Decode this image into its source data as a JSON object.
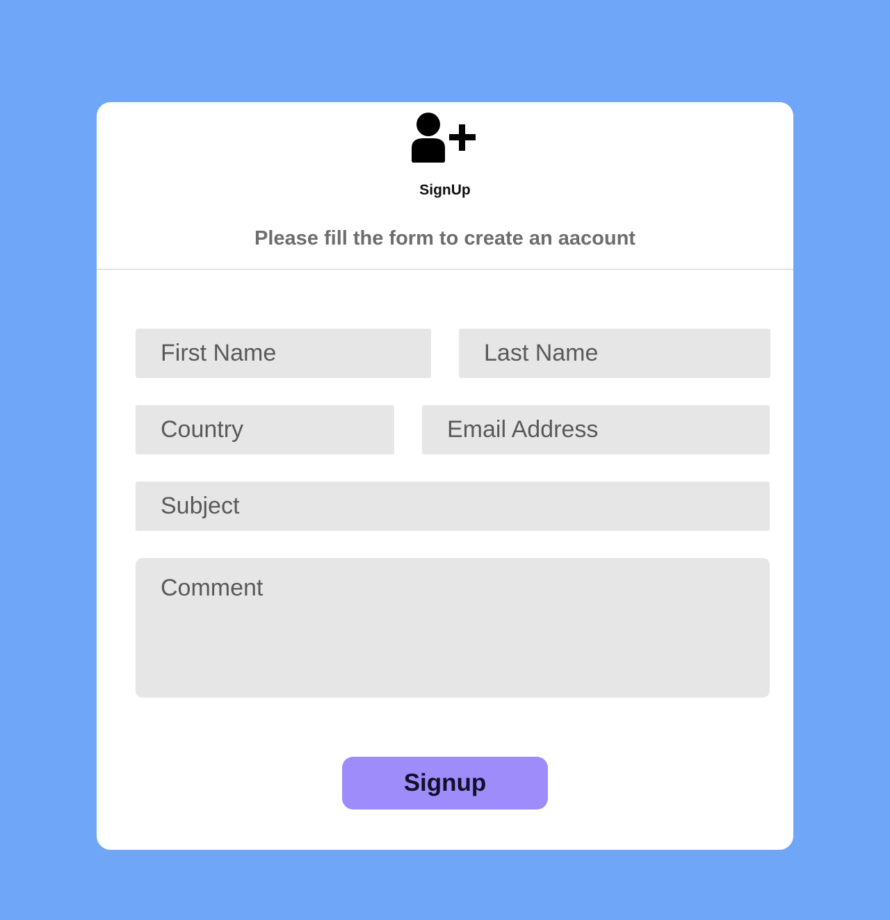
{
  "header": {
    "icon": "user-plus-icon",
    "title": "SignUp",
    "subtitle": "Please fill the form to create an aacount"
  },
  "form": {
    "first_name": {
      "placeholder": "First Name",
      "value": ""
    },
    "last_name": {
      "placeholder": "Last Name",
      "value": ""
    },
    "country": {
      "placeholder": "Country",
      "value": ""
    },
    "email": {
      "placeholder": "Email Address",
      "value": ""
    },
    "subject": {
      "placeholder": "Subject",
      "value": ""
    },
    "comment": {
      "placeholder": "Comment",
      "value": ""
    },
    "submit_label": "Signup"
  },
  "colors": {
    "page_background": "#70a6f7",
    "card_background": "#ffffff",
    "field_background": "#e6e6e6",
    "button_background": "#9e8cfa"
  }
}
